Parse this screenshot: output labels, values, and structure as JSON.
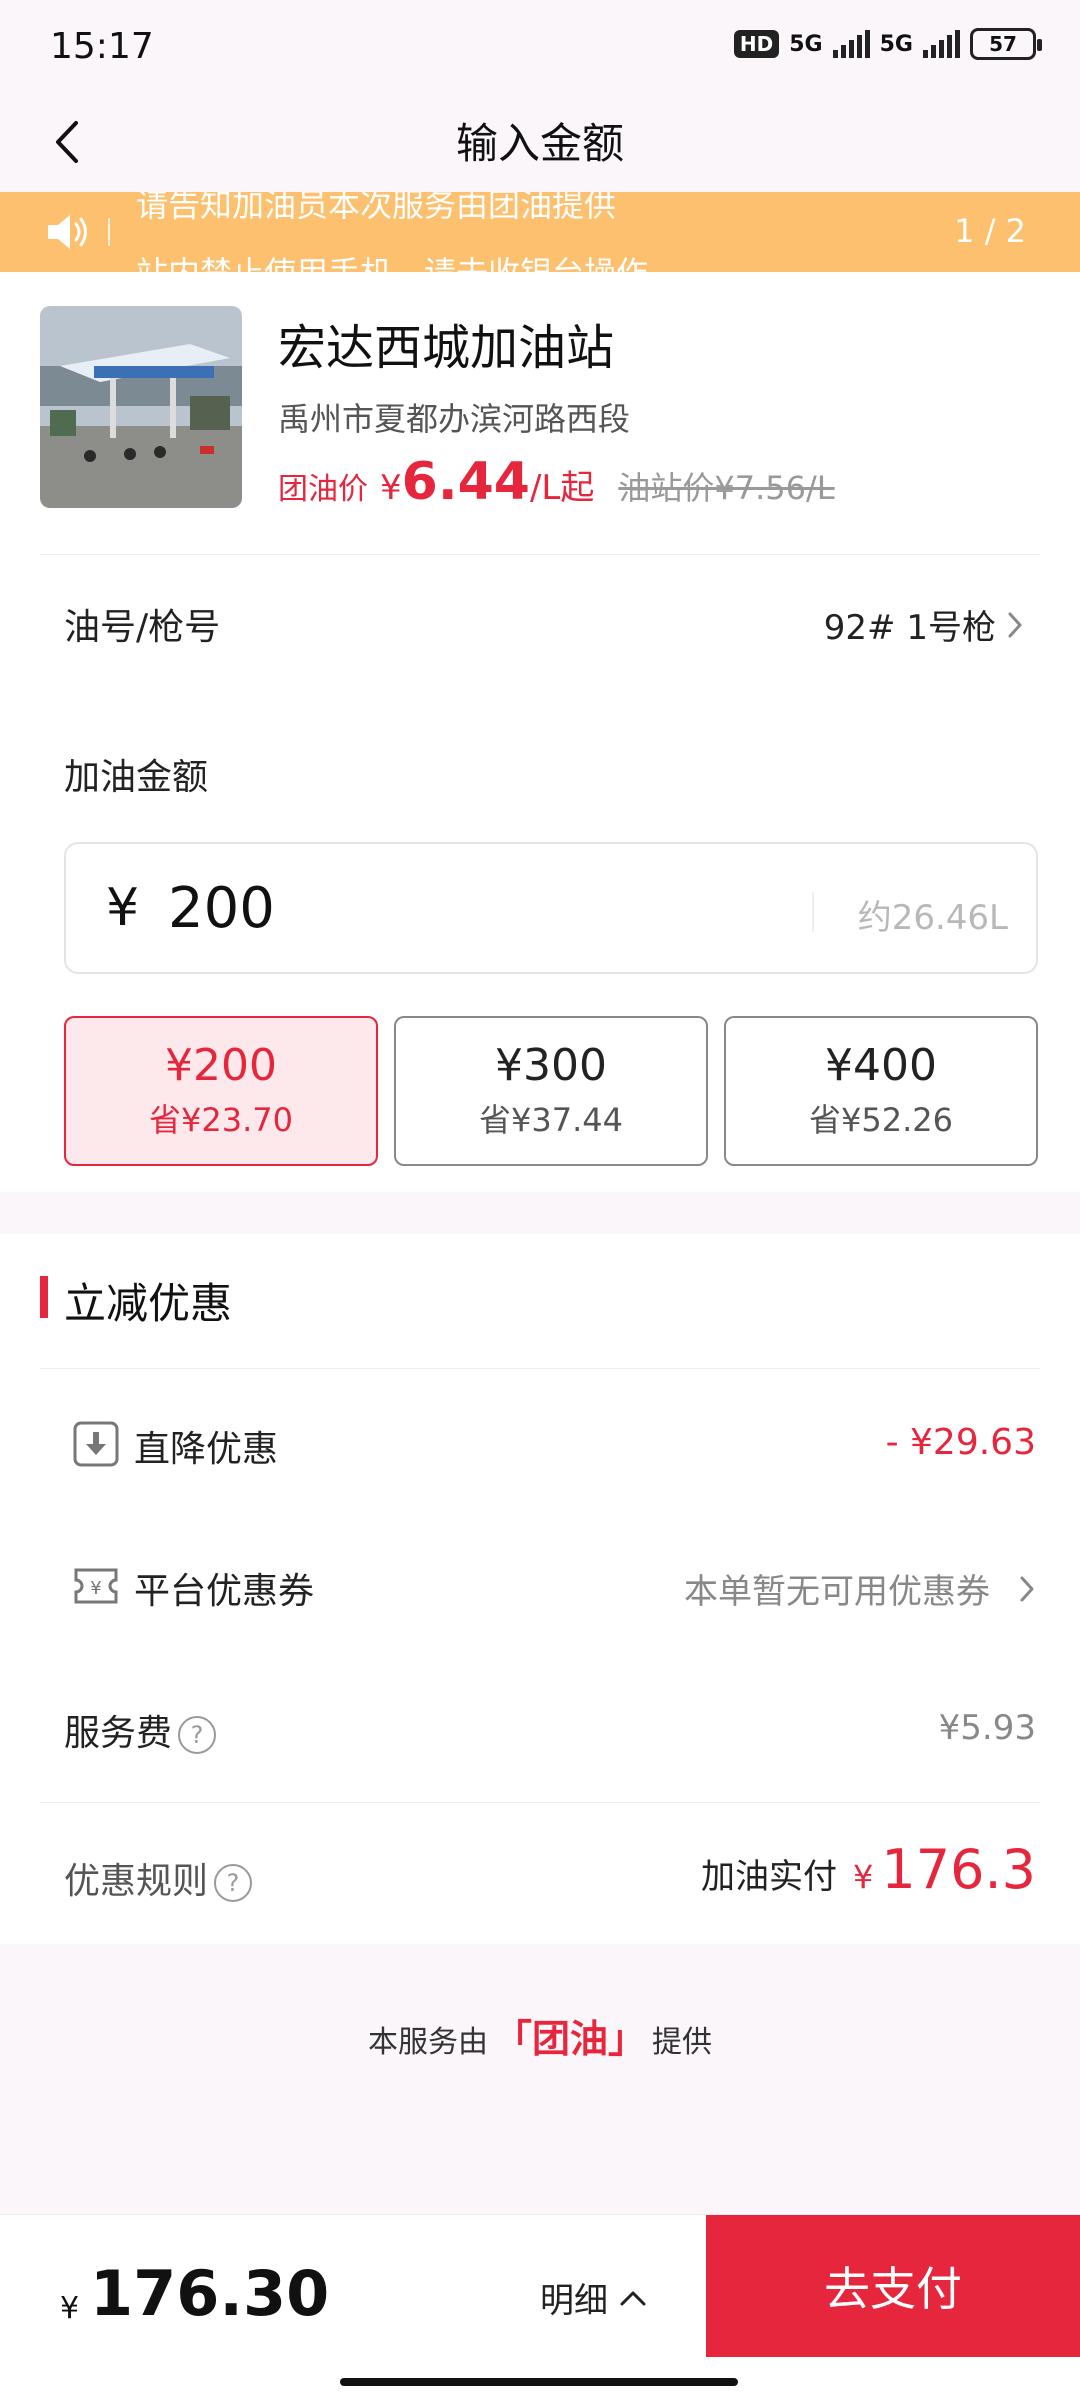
{
  "status_bar": {
    "time": "15:17",
    "hd_label": "HD",
    "network_1": "5G",
    "network_2": "5G",
    "battery": "57"
  },
  "nav": {
    "title": "输入金额",
    "back_icon": "chevron-left-icon"
  },
  "notice": {
    "line1": "请告知加油员本次服务由团油提供",
    "line2": "站内禁止使用手机，请去收银台操作",
    "page": "1 / 2",
    "icon": "speaker-icon"
  },
  "station": {
    "name": "宏达西城加油站",
    "address": "禹州市夏都办滨河路西段",
    "group_price_label": "团油价",
    "yen": "¥",
    "group_price": "6.44",
    "group_price_unit": "/L起",
    "station_price": "油站价¥7.56/L"
  },
  "fuel": {
    "label": "油号/枪号",
    "value": "92# 1号枪"
  },
  "amount": {
    "label": "加油金额",
    "currency": "¥",
    "value": "200",
    "liters": "约26.46L"
  },
  "quick_amounts": [
    {
      "amount": "¥200",
      "save": "省¥23.70",
      "selected": true
    },
    {
      "amount": "¥300",
      "save": "省¥37.44",
      "selected": false
    },
    {
      "amount": "¥400",
      "save": "省¥52.26",
      "selected": false
    }
  ],
  "discounts": {
    "section_title": "立减优惠",
    "direct_label": "直降优惠",
    "direct_value": "- ¥29.63",
    "coupon_label": "平台优惠券",
    "coupon_value": "本单暂无可用优惠券",
    "service_fee_label": "服务费",
    "service_fee_value": "¥5.93",
    "rules_label": "优惠规则",
    "payable_label": "加油实付",
    "payable_yen": "¥",
    "payable_value": "176.3"
  },
  "provider": {
    "prefix": "本服务由",
    "brand": "「团油」",
    "suffix": "提供"
  },
  "footer": {
    "total_yen": "¥",
    "total_value": "176.30",
    "details_label": "明细",
    "pay_label": "去支付"
  },
  "colors": {
    "accent": "#e5263d",
    "notice_bg": "#fdc06f",
    "page_bg": "#fbf6fa"
  }
}
